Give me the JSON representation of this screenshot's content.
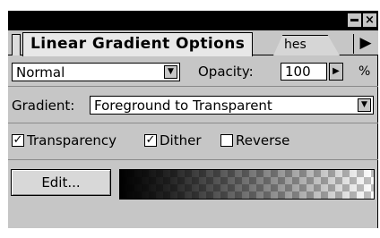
{
  "palette": {
    "tabs": [
      {
        "label": "Linear Gradient Options",
        "active": true
      },
      {
        "label": "hes",
        "active": false
      }
    ],
    "title_buttons": {
      "minimize": "minimize-icon",
      "close": "×"
    },
    "tab_scroll_glyph": "▶"
  },
  "blend": {
    "mode": "Normal",
    "opacity_label": "Opacity:",
    "opacity_value": "100",
    "opacity_unit": "%"
  },
  "gradient": {
    "label": "Gradient:",
    "value": "Foreground to Transparent"
  },
  "options": [
    {
      "label": "Transparency",
      "checked": true
    },
    {
      "label": "Dither",
      "checked": true
    },
    {
      "label": "Reverse",
      "checked": false
    }
  ],
  "edit": {
    "button_label": "Edit...",
    "preview": {
      "start_color": "#000000",
      "end": "transparent"
    }
  },
  "glyphs": {
    "dropdown": "▼",
    "stepper": "▶",
    "check": "✓"
  }
}
